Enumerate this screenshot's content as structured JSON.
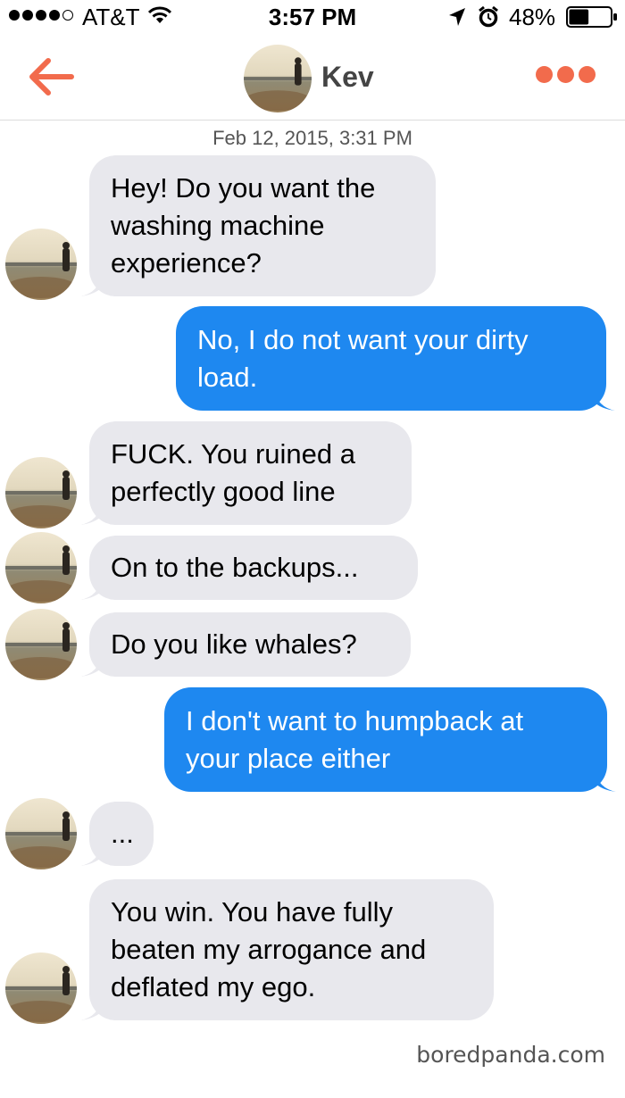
{
  "status_bar": {
    "carrier": "AT&T",
    "time": "3:57 PM",
    "battery": "48%",
    "battery_level": 0.48
  },
  "header": {
    "contact_name": "Kev"
  },
  "thread": {
    "timestamp": "Feb 12, 2015, 3:31 PM",
    "messages": [
      {
        "sender": "them",
        "lines": [
          "Hey! Do you want the",
          "washing machine",
          "experience?"
        ]
      },
      {
        "sender": "me",
        "lines": [
          "No, I do not want your dirty",
          "load."
        ]
      },
      {
        "sender": "them",
        "lines": [
          "FUCK. You ruined a",
          "perfectly good line"
        ]
      },
      {
        "sender": "them",
        "lines": [
          "On to the backups..."
        ]
      },
      {
        "sender": "them",
        "lines": [
          "Do you like whales?"
        ]
      },
      {
        "sender": "me",
        "lines": [
          "I don't want to humpback at",
          "your place either"
        ]
      },
      {
        "sender": "them",
        "lines": [
          "..."
        ]
      },
      {
        "sender": "them",
        "lines": [
          "You win. You have fully",
          "beaten my arrogance and",
          "deflated my ego."
        ]
      }
    ]
  },
  "watermark": "boredpanda.com",
  "colors": {
    "accent": "#f26b4c",
    "outgoing_bubble": "#1e88f0",
    "incoming_bubble": "#e8e8ed"
  },
  "icons": [
    "wifi-icon",
    "location-icon",
    "alarm-icon",
    "battery-icon",
    "back-arrow-icon",
    "more-dots-icon"
  ]
}
